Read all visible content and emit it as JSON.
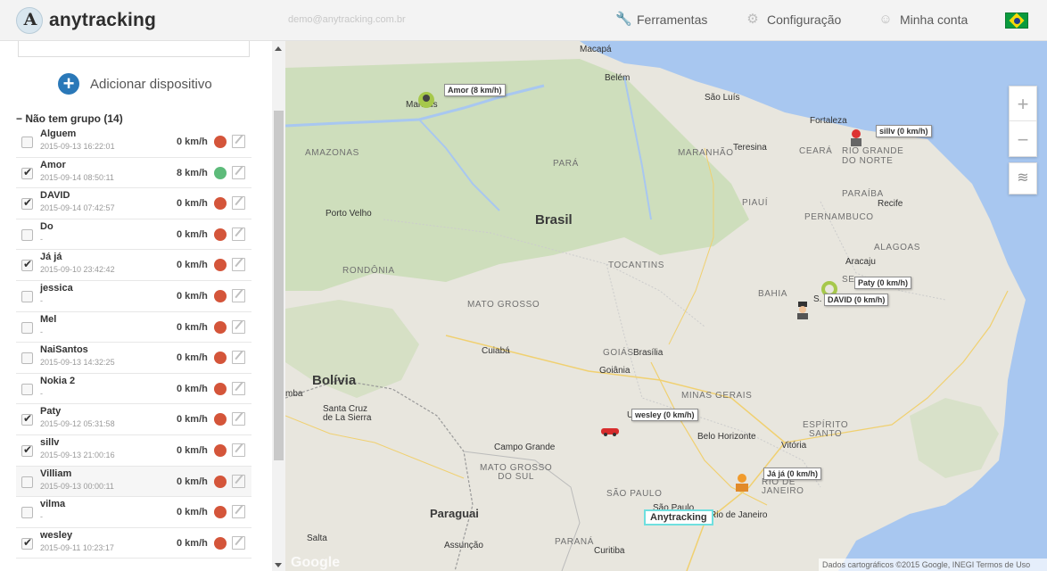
{
  "header": {
    "logo_mark": "A",
    "logo_text": "anytracking",
    "user_email": "demo@anytracking.com.br",
    "nav": [
      {
        "label": "Ferramentas",
        "icon": "wrench-icon"
      },
      {
        "label": "Configuração",
        "icon": "gear-icon"
      },
      {
        "label": "Minha conta",
        "icon": "user-icon"
      }
    ],
    "language_flag": "brazil-flag-icon"
  },
  "sidebar": {
    "add_device_label": "Adicionar dispositivo",
    "group_label": "Não tem grupo (14)",
    "devices": [
      {
        "name": "Alguem",
        "time": "2015-09-13 16:22:01",
        "speed": "0 km/h",
        "checked": false,
        "status": "stopped"
      },
      {
        "name": "Amor",
        "time": "2015-09-14 08:50:11",
        "speed": "8 km/h",
        "checked": true,
        "status": "moving"
      },
      {
        "name": "DAVID",
        "time": "2015-09-14 07:42:57",
        "speed": "0 km/h",
        "checked": true,
        "status": "stopped"
      },
      {
        "name": "Do",
        "time": "-",
        "speed": "0 km/h",
        "checked": false,
        "status": "stopped"
      },
      {
        "name": "Já já",
        "time": "2015-09-10 23:42:42",
        "speed": "0 km/h",
        "checked": true,
        "status": "stopped"
      },
      {
        "name": "jessica",
        "time": "-",
        "speed": "0 km/h",
        "checked": false,
        "status": "stopped"
      },
      {
        "name": "Mel",
        "time": "-",
        "speed": "0 km/h",
        "checked": false,
        "status": "stopped"
      },
      {
        "name": "NaiSantos",
        "time": "2015-09-13 14:32:25",
        "speed": "0 km/h",
        "checked": false,
        "status": "stopped"
      },
      {
        "name": "Nokia 2",
        "time": "-",
        "speed": "0 km/h",
        "checked": false,
        "status": "stopped"
      },
      {
        "name": "Paty",
        "time": "2015-09-12 05:31:58",
        "speed": "0 km/h",
        "checked": true,
        "status": "stopped"
      },
      {
        "name": "sillv",
        "time": "2015-09-13 21:00:16",
        "speed": "0 km/h",
        "checked": true,
        "status": "stopped"
      },
      {
        "name": "Villiam",
        "time": "2015-09-13 00:00:11",
        "speed": "0 km/h",
        "checked": false,
        "status": "stopped"
      },
      {
        "name": "vilma",
        "time": "-",
        "speed": "0 km/h",
        "checked": false,
        "status": "stopped"
      },
      {
        "name": "wesley",
        "time": "2015-09-11 10:23:17",
        "speed": "0 km/h",
        "checked": true,
        "status": "stopped"
      }
    ],
    "status_colors": {
      "stopped": "#d4553a",
      "moving": "#5dbb7a"
    }
  },
  "map": {
    "labels": {
      "macapa": "Macapá",
      "belem": "Belém",
      "sao_luis": "São Luís",
      "fortaleza": "Fortaleza",
      "manaus": "Manaus",
      "amazonas": "AMAZONAS",
      "para": "PARÁ",
      "maranhao": "MARANHÃO",
      "teresina": "Teresina",
      "ceara": "CEARÁ",
      "rio_grande_do_norte": "RIO GRANDE\nDO NORTE",
      "paraiba": "PARAÍBA",
      "piaui": "PIAUÍ",
      "recife": "Recife",
      "pernambuco": "PERNAMBUCO",
      "porto_velho": "Porto Velho",
      "brasil": "Brasil",
      "alagoas": "ALAGOAS",
      "aracaju": "Aracaju",
      "rondonia": "RONDÔNIA",
      "tocantins": "TOCANTINS",
      "bahia": "BAHIA",
      "sergipe": "SE",
      "salvador": "S.",
      "mato_grosso": "MATO GROSSO",
      "cuiaba": "Cuiabá",
      "goias": "GOIÁS",
      "brasilia": "Brasília",
      "goiania": "Goiânia",
      "bolivia": "Bolívia",
      "santa_cruz": "Santa Cruz\nde La Sierra",
      "minas_gerais": "MINAS GERAIS",
      "espirito_santo": "ESPÍRITO\nSANTO",
      "vitoria": "Vitória",
      "uberlandia": "U",
      "belo_horizonte": "Belo Horizonte",
      "campo_grande": "Campo Grande",
      "mato_grosso_do_sul": "MATO GROSSO\nDO SUL",
      "rio_de_janeiro_state": "RIO DE\nJANEIRO",
      "sao_paulo_state": "SÃO PAULO",
      "sao_paulo_city": "São Paulo",
      "rio_de_janeiro": "Rio de Janeiro",
      "paraguai": "Paraguai",
      "salta": "Salta",
      "assuncao": "Assunção",
      "parana": "PARANÁ",
      "curitiba": "Curitiba",
      "bolivia_left": "mba"
    },
    "markers": {
      "amor": "Amor (8 km/h)",
      "sillv": "sillv (0 km/h)",
      "paty": "Paty (0 km/h)",
      "david": "DAVID (0 km/h)",
      "wesley": "wesley (0 km/h)",
      "ja_ja": "Já já (0 km/h)"
    },
    "home_label": "Anytracking",
    "zoom_in": "+",
    "zoom_out": "−",
    "google_logo": "Google",
    "attribution": "Dados cartográficos ©2015 Google, INEGI  Termos de Uso",
    "colors": {
      "ocean": "#a8c7f0",
      "land": "#e8e6de",
      "forest": "#c6dbb0"
    }
  }
}
